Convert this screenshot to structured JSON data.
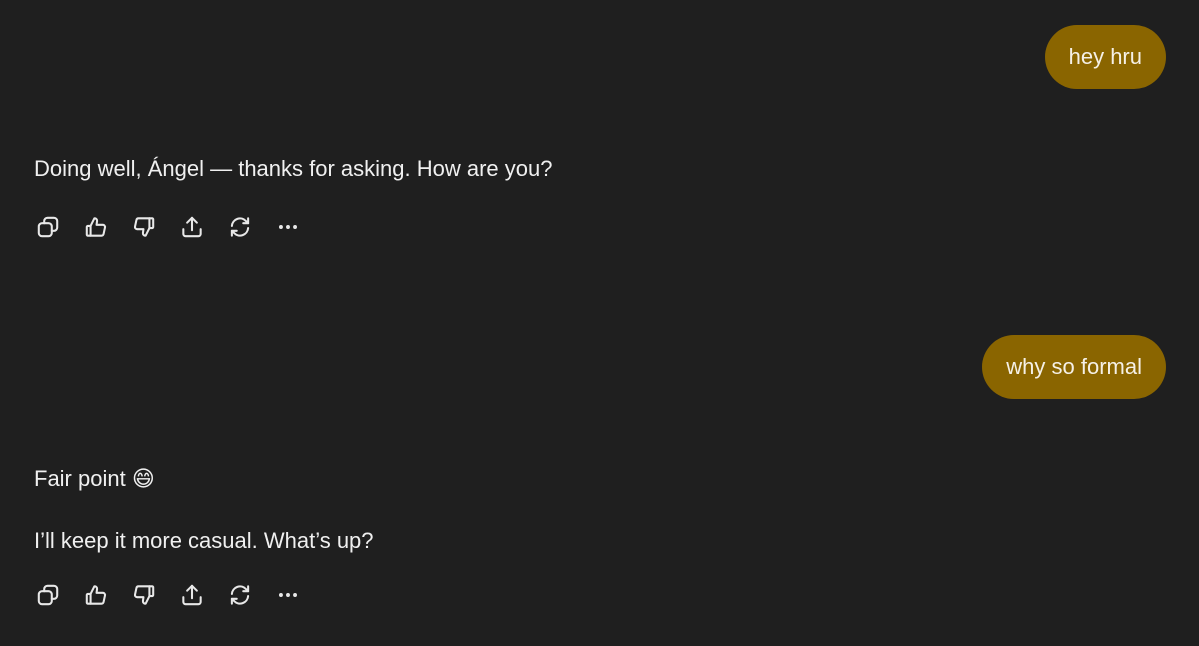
{
  "messages": [
    {
      "role": "user",
      "text": "hey hru"
    },
    {
      "role": "assistant",
      "text": "Doing well, Ángel — thanks for asking. How are you?"
    },
    {
      "role": "user",
      "text": "why so formal"
    },
    {
      "role": "assistant",
      "paragraphs": [
        "Fair point 😄",
        "I’ll keep it more casual. What’s up?"
      ]
    }
  ],
  "actions": [
    "copy-icon",
    "thumbs-up-icon",
    "thumbs-down-icon",
    "share-icon",
    "regenerate-icon",
    "more-icon"
  ],
  "colors": {
    "background": "#1f1f1f",
    "user_bubble": "#8a6500",
    "text": "#f0f0f0"
  }
}
